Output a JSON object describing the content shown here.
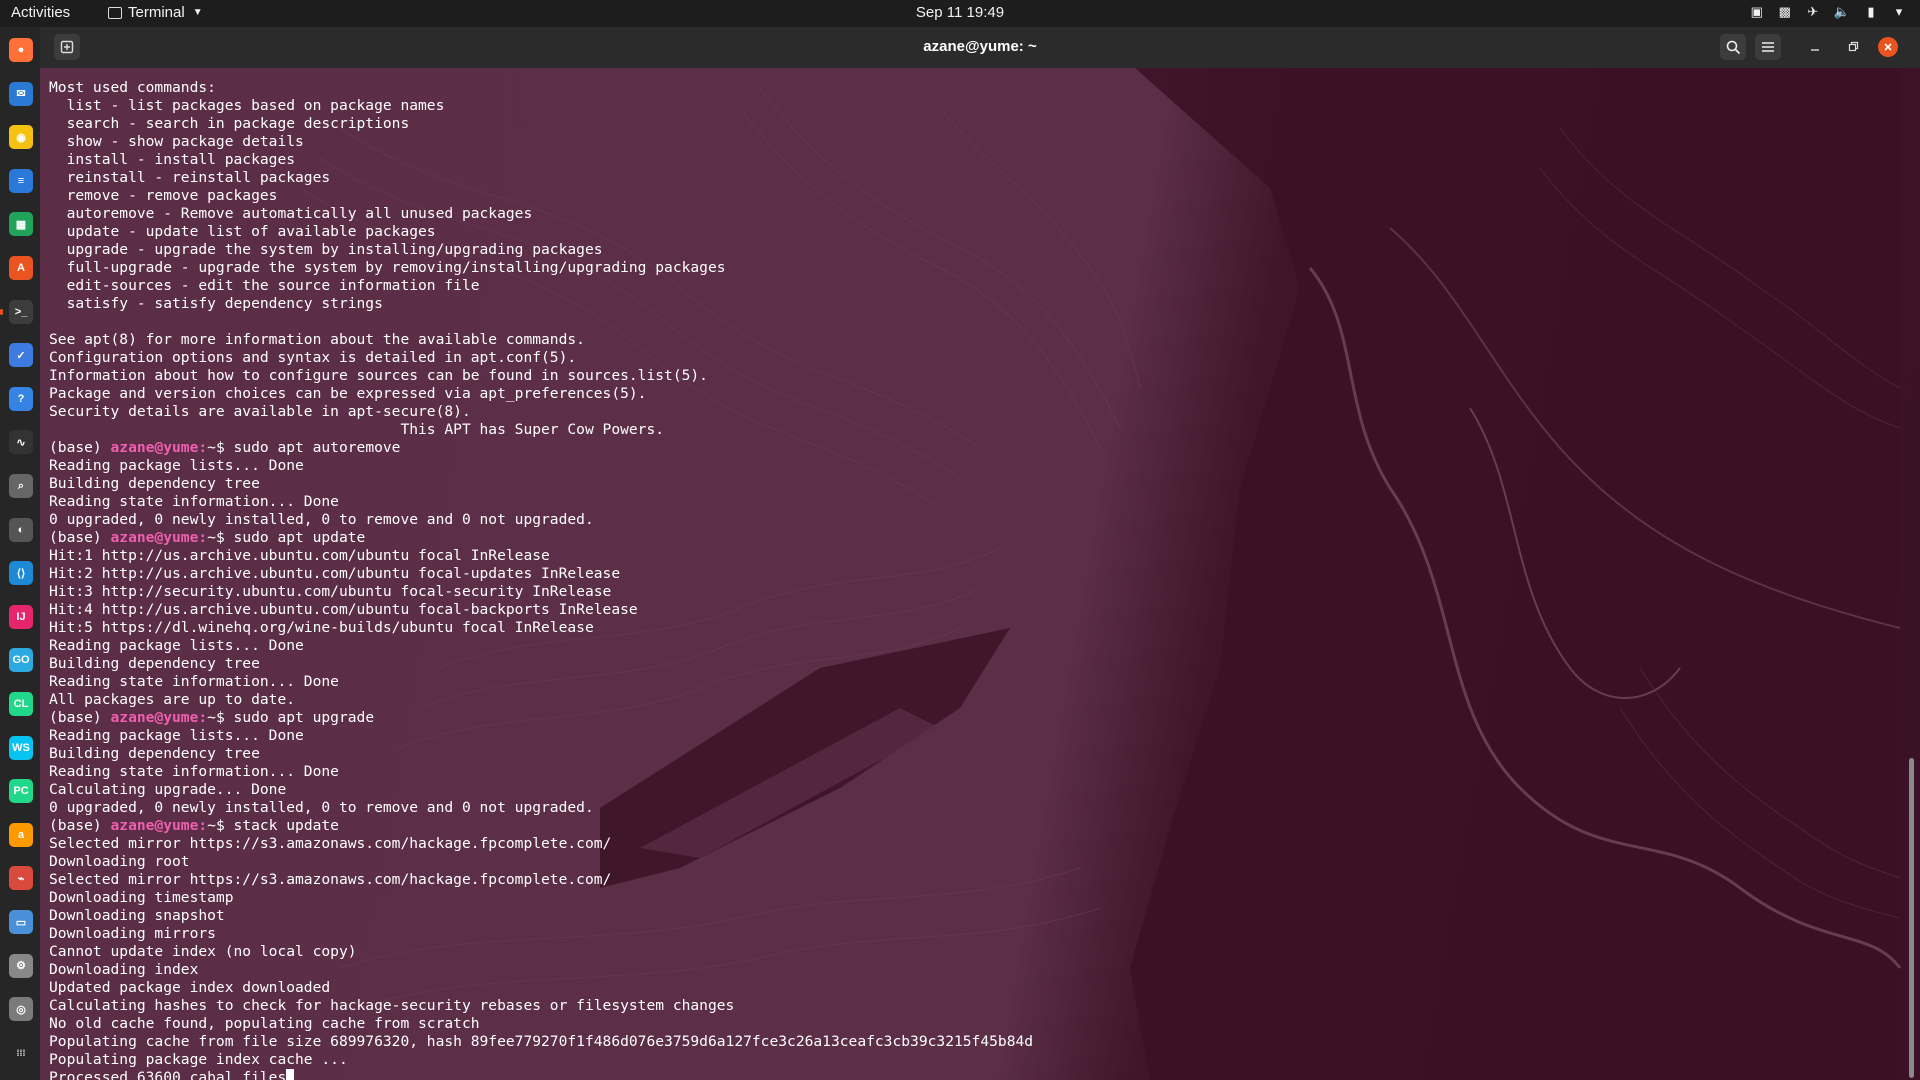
{
  "topbar": {
    "activities": "Activities",
    "app_name": "Terminal",
    "clock": "Sep 11  19:49",
    "tray_icons": [
      "network-icon",
      "vpn-icon",
      "airplane-icon",
      "volume-icon",
      "battery-icon",
      "system-menu-icon"
    ]
  },
  "dock": {
    "items": [
      {
        "name": "firefox-icon",
        "color": "#ff7139"
      },
      {
        "name": "thunderbird-icon",
        "color": "#2a7ad3"
      },
      {
        "name": "rhythmbox-icon",
        "color": "#f5c211"
      },
      {
        "name": "writer-icon",
        "color": "#2a78d7"
      },
      {
        "name": "calc-icon",
        "color": "#22a35a"
      },
      {
        "name": "software-icon",
        "color": "#e95420"
      },
      {
        "name": "terminal-icon",
        "color": "#3c3c3c"
      },
      {
        "name": "todo-icon",
        "color": "#3d7be0"
      },
      {
        "name": "help-icon",
        "color": "#3584e4"
      },
      {
        "name": "system-monitor-icon",
        "color": "#333333"
      },
      {
        "name": "image-viewer-icon",
        "color": "#666666"
      },
      {
        "name": "vision-icon",
        "color": "#555555"
      },
      {
        "name": "vscode-icon",
        "color": "#1e8ad6"
      },
      {
        "name": "intellij-icon",
        "color": "#e5266c"
      },
      {
        "name": "goland-icon",
        "color": "#2ca9e1"
      },
      {
        "name": "clion-icon",
        "color": "#21d789"
      },
      {
        "name": "webstorm-icon",
        "color": "#07c3f2"
      },
      {
        "name": "pycharm-icon",
        "color": "#21d789"
      },
      {
        "name": "amazon-icon",
        "color": "#ff9900"
      },
      {
        "name": "monitor-graph-icon",
        "color": "#d94a3d"
      },
      {
        "name": "remote-desktop-icon",
        "color": "#4a90d9"
      },
      {
        "name": "settings-icon",
        "color": "#888888"
      },
      {
        "name": "disk-icon",
        "color": "#7a7a7a"
      },
      {
        "name": "show-apps-icon",
        "color": "#262626"
      }
    ]
  },
  "window": {
    "title": "azane@yume: ~"
  },
  "terminal": {
    "prompt_prefix": "(base) ",
    "prompt_user": "azane@yume:",
    "prompt_suffix": "~$ ",
    "lines": [
      {
        "text": "Most used commands:"
      },
      {
        "text": "  list - list packages based on package names"
      },
      {
        "text": "  search - search in package descriptions"
      },
      {
        "text": "  show - show package details"
      },
      {
        "text": "  install - install packages"
      },
      {
        "text": "  reinstall - reinstall packages"
      },
      {
        "text": "  remove - remove packages"
      },
      {
        "text": "  autoremove - Remove automatically all unused packages"
      },
      {
        "text": "  update - update list of available packages"
      },
      {
        "text": "  upgrade - upgrade the system by installing/upgrading packages"
      },
      {
        "text": "  full-upgrade - upgrade the system by removing/installing/upgrading packages"
      },
      {
        "text": "  edit-sources - edit the source information file"
      },
      {
        "text": "  satisfy - satisfy dependency strings"
      },
      {
        "text": ""
      },
      {
        "text": "See apt(8) for more information about the available commands."
      },
      {
        "text": "Configuration options and syntax is detailed in apt.conf(5)."
      },
      {
        "text": "Information about how to configure sources can be found in sources.list(5)."
      },
      {
        "text": "Package and version choices can be expressed via apt_preferences(5)."
      },
      {
        "text": "Security details are available in apt-secure(8)."
      },
      {
        "text": "                                        This APT has Super Cow Powers."
      },
      {
        "prompt": true,
        "text": "sudo apt autoremove"
      },
      {
        "text": "Reading package lists... Done"
      },
      {
        "text": "Building dependency tree"
      },
      {
        "text": "Reading state information... Done"
      },
      {
        "text": "0 upgraded, 0 newly installed, 0 to remove and 0 not upgraded."
      },
      {
        "prompt": true,
        "text": "sudo apt update"
      },
      {
        "text": "Hit:1 http://us.archive.ubuntu.com/ubuntu focal InRelease"
      },
      {
        "text": "Hit:2 http://us.archive.ubuntu.com/ubuntu focal-updates InRelease"
      },
      {
        "text": "Hit:3 http://security.ubuntu.com/ubuntu focal-security InRelease"
      },
      {
        "text": "Hit:4 http://us.archive.ubuntu.com/ubuntu focal-backports InRelease"
      },
      {
        "text": "Hit:5 https://dl.winehq.org/wine-builds/ubuntu focal InRelease"
      },
      {
        "text": "Reading package lists... Done"
      },
      {
        "text": "Building dependency tree"
      },
      {
        "text": "Reading state information... Done"
      },
      {
        "text": "All packages are up to date."
      },
      {
        "prompt": true,
        "text": "sudo apt upgrade"
      },
      {
        "text": "Reading package lists... Done"
      },
      {
        "text": "Building dependency tree"
      },
      {
        "text": "Reading state information... Done"
      },
      {
        "text": "Calculating upgrade... Done"
      },
      {
        "text": "0 upgraded, 0 newly installed, 0 to remove and 0 not upgraded."
      },
      {
        "prompt": true,
        "text": "stack update"
      },
      {
        "text": "Selected mirror https://s3.amazonaws.com/hackage.fpcomplete.com/"
      },
      {
        "text": "Downloading root"
      },
      {
        "text": "Selected mirror https://s3.amazonaws.com/hackage.fpcomplete.com/"
      },
      {
        "text": "Downloading timestamp"
      },
      {
        "text": "Downloading snapshot"
      },
      {
        "text": "Downloading mirrors"
      },
      {
        "text": "Cannot update index (no local copy)"
      },
      {
        "text": "Downloading index"
      },
      {
        "text": "Updated package index downloaded"
      },
      {
        "text": "Calculating hashes to check for hackage-security rebases or filesystem changes"
      },
      {
        "text": "No old cache found, populating cache from scratch"
      },
      {
        "text": "Populating cache from file size 689976320, hash 89fee779270f1f486d076e3759d6a127fce3c26a13ceafc3cb39c3215f45b84d"
      },
      {
        "text": "Populating package index cache ..."
      },
      {
        "text": "Processed 63600 cabal files",
        "cursor": true
      }
    ]
  }
}
